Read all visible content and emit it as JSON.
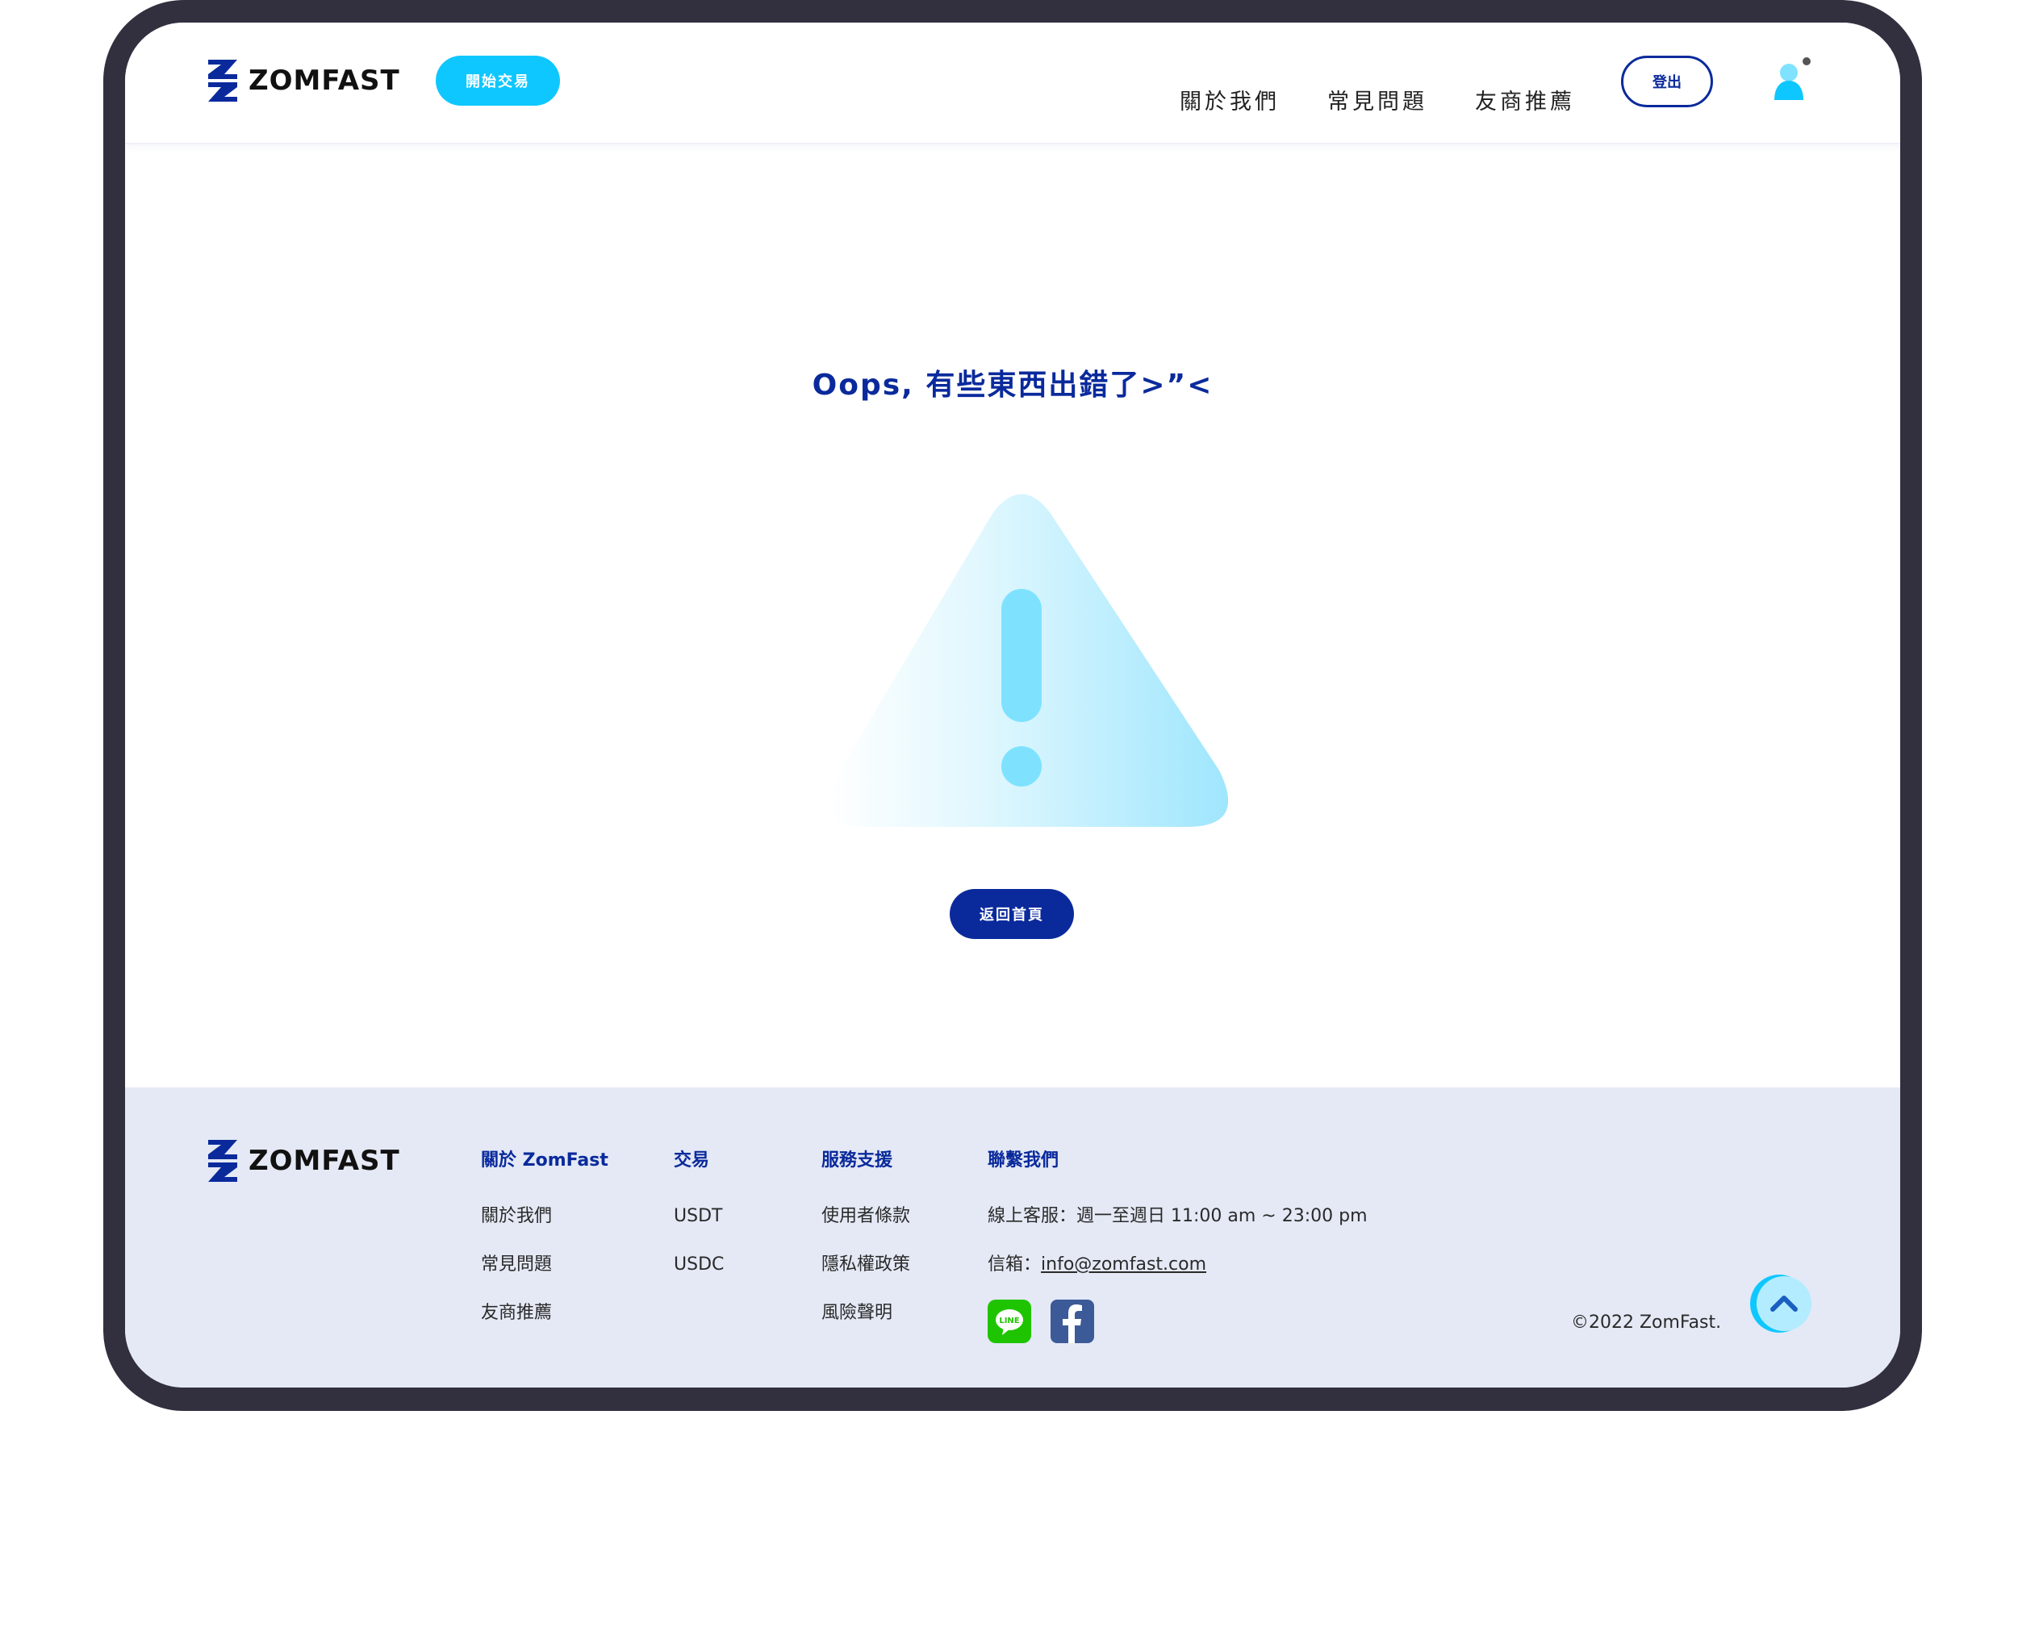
{
  "header": {
    "logo_text": "ZOMFAST",
    "start_trading": "開始交易",
    "nav": [
      "關於我們",
      "常見問題",
      "友商推薦"
    ],
    "logout": "登出"
  },
  "main": {
    "title": "Oops, 有些東西出錯了>”<",
    "home_button": "返回首頁"
  },
  "footer": {
    "logo_text": "ZOMFAST",
    "columns": [
      {
        "heading": "關於 ZomFast",
        "items": [
          "關於我們",
          "常見問題",
          "友商推薦"
        ]
      },
      {
        "heading": "交易",
        "items": [
          "USDT",
          "USDC"
        ]
      },
      {
        "heading": "服務支援",
        "items": [
          "使用者條款",
          "隱私權政策",
          "風險聲明"
        ]
      },
      {
        "heading": "聯繫我們",
        "service_hours": "線上客服：週一至週日 11:00 am ~ 23:00 pm",
        "email_label": "信箱：",
        "email": "info@zomfast.com"
      }
    ],
    "social": [
      "line-icon",
      "facebook-icon"
    ],
    "copyright": "©2022 ZomFast."
  },
  "colors": {
    "navy": "#0a2a9c",
    "cyan": "#0fc7ff",
    "footer_bg": "#e4e9f5",
    "frame": "#32303f"
  }
}
